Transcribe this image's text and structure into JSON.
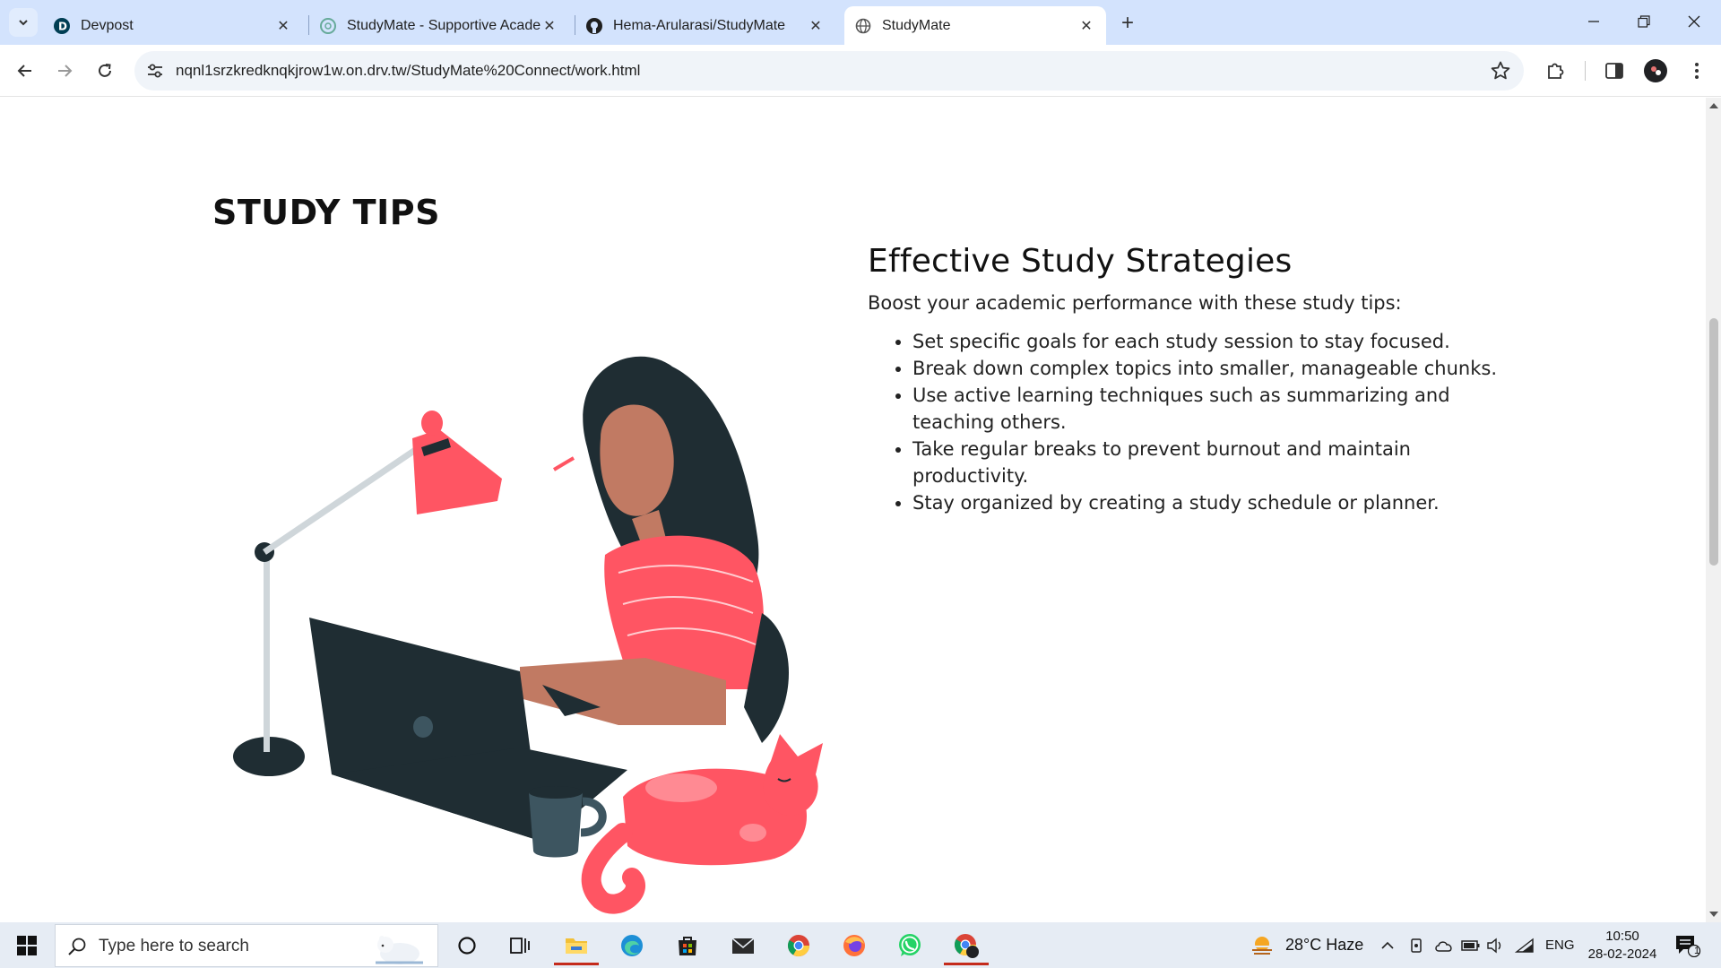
{
  "browser": {
    "tabs": [
      {
        "title": "Devpost",
        "active": false
      },
      {
        "title": "StudyMate - Supportive Academ",
        "active": false
      },
      {
        "title": "Hema-Arularasi/StudyMate",
        "active": false
      },
      {
        "title": "StudyMate",
        "active": true
      }
    ],
    "new_tab": "+",
    "url": "nqnl1srzkredknqkjrow1w.on.drv.tw/StudyMate%20Connect/work.html"
  },
  "page": {
    "heading": "STUDY TIPS",
    "section_title": "Effective Study Strategies",
    "intro": "Boost your academic performance with these study tips:",
    "tips": [
      "Set specific goals for each study session to stay focused.",
      "Break down complex topics into smaller, manageable chunks.",
      "Use active learning techniques such as summarizing and teaching others.",
      "Take regular breaks to prevent burnout and maintain productivity.",
      "Stay organized by creating a study schedule or planner."
    ],
    "accent_color": "#ff5563",
    "dark_color": "#1f2d33"
  },
  "taskbar": {
    "search_placeholder": "Type here to search",
    "weather": "28°C  Haze",
    "language": "ENG",
    "time": "10:50",
    "date": "28-02-2024",
    "notification_count": "1"
  }
}
